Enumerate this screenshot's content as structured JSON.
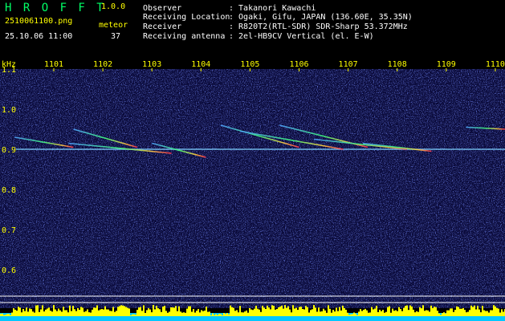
{
  "app": {
    "logo": "H R O F F T",
    "version": "1.0.0",
    "filename": "2510061100.png",
    "meteor_label": "meteor",
    "datetime": "25.10.06 11:00",
    "meteor_count": "37"
  },
  "info": [
    {
      "label": "Observer",
      "value": ": Takanori Kawachi"
    },
    {
      "label": "Receiving Location",
      "value": ": Ogaki, Gifu, JAPAN (136.60E, 35.35N)"
    },
    {
      "label": "Receiver",
      "value": ": R820T2(RTL-SDR) SDR-Sharp 53.372MHz"
    },
    {
      "label": "Receiving antenna",
      "value": ": 2el-HB9CV Vertical (el. E-W)"
    }
  ],
  "axes": {
    "y_unit": "kHz",
    "y_ticks": [
      "1.1",
      "1.0",
      "0.9",
      "0.8",
      "0.7",
      "0.6"
    ],
    "x_ticks": [
      "1101",
      "1102",
      "1103",
      "1104",
      "1105",
      "1106",
      "1107",
      "1108",
      "1109",
      "1110"
    ]
  },
  "colors": {
    "background": "#000000",
    "spectrogram": "#0a0a3a",
    "carrier": "#7fd0ff",
    "text_green": "#00ff66",
    "text_yellow": "#ffff00",
    "bars": "#ffff00",
    "bars_base": "#00c8ff"
  },
  "chart_data": {
    "type": "heatmap",
    "xlabel": "",
    "ylabel": "kHz",
    "ylim": [
      0.58,
      1.18
    ],
    "x_ticks": [
      "1101",
      "1102",
      "1103",
      "1104",
      "1105",
      "1106",
      "1107",
      "1108",
      "1109",
      "1110"
    ],
    "carrier_khz": 0.9,
    "meteor_traces": [
      {
        "x_start": 1100.2,
        "y_start": 0.93,
        "x_end": 1101.4,
        "y_end": 0.905
      },
      {
        "x_start": 1101.4,
        "y_start": 0.95,
        "x_end": 1102.7,
        "y_end": 0.905
      },
      {
        "x_start": 1101.3,
        "y_start": 0.915,
        "x_end": 1103.4,
        "y_end": 0.89
      },
      {
        "x_start": 1103.0,
        "y_start": 0.915,
        "x_end": 1104.1,
        "y_end": 0.88
      },
      {
        "x_start": 1104.4,
        "y_start": 0.96,
        "x_end": 1106.0,
        "y_end": 0.905
      },
      {
        "x_start": 1104.8,
        "y_start": 0.945,
        "x_end": 1106.9,
        "y_end": 0.9
      },
      {
        "x_start": 1105.6,
        "y_start": 0.96,
        "x_end": 1107.4,
        "y_end": 0.905
      },
      {
        "x_start": 1106.3,
        "y_start": 0.925,
        "x_end": 1108.2,
        "y_end": 0.9
      },
      {
        "x_start": 1107.3,
        "y_start": 0.915,
        "x_end": 1108.7,
        "y_end": 0.895
      },
      {
        "x_start": 1109.4,
        "y_start": 0.955,
        "x_end": 1110.2,
        "y_end": 0.95
      }
    ]
  }
}
